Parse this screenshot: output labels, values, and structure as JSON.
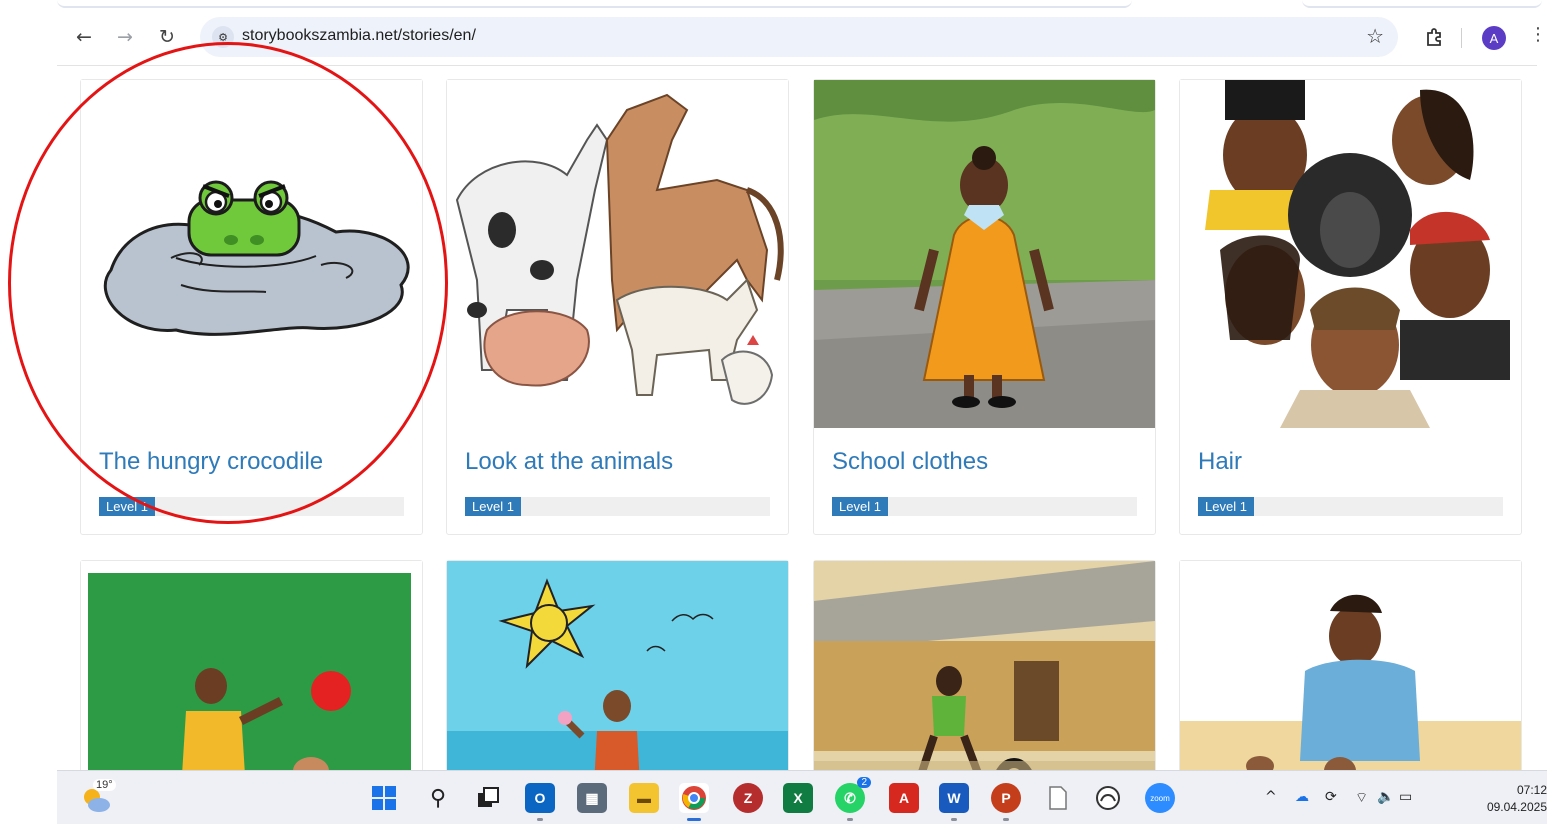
{
  "browser": {
    "url": "storybookszambia.net/stories/en/",
    "profile_initial": "A"
  },
  "stories": [
    {
      "title": "The hungry crocodile",
      "level": "Level 1"
    },
    {
      "title": "Look at the animals",
      "level": "Level 1"
    },
    {
      "title": "School clothes",
      "level": "Level 1"
    },
    {
      "title": "Hair",
      "level": "Level 1"
    }
  ],
  "taskbar": {
    "temperature": "19°",
    "whatsapp_badge": "2",
    "zoom_label": "zoom",
    "time": "07:12",
    "date": "09.04.2025"
  },
  "colors": {
    "link": "#2f7ab9",
    "level_badge": "#2f7ab9",
    "annotation_circle": "#e41414"
  }
}
